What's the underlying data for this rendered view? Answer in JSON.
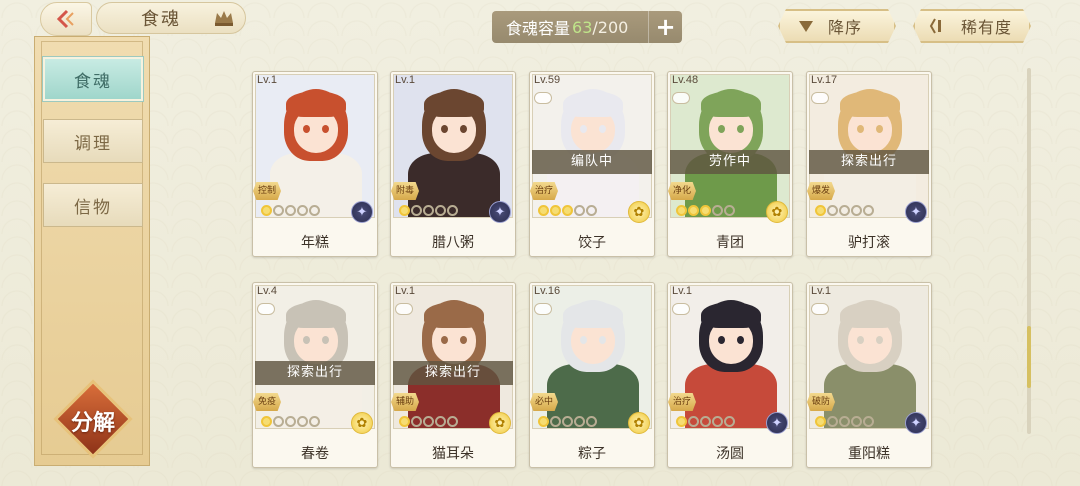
{
  "header": {
    "title": "食魂",
    "capacity_label": "食魂容量",
    "capacity_current": "63",
    "capacity_max": "/200",
    "add_label": "+",
    "sort_order_label": "降序",
    "sort_by_label": "稀有度"
  },
  "sidebar": {
    "tabs": [
      {
        "label": "食魂",
        "active": true
      },
      {
        "label": "调理",
        "active": false
      },
      {
        "label": "信物",
        "active": false
      }
    ],
    "decompose_label": "分解"
  },
  "scroll": {
    "position_fraction": 0.85
  },
  "cards": [
    {
      "level": "Lv.1",
      "name": "年糕",
      "role": "控制",
      "stars_filled": 1,
      "stars_total": 5,
      "element": "dark",
      "status": "",
      "palette": {
        "hair": "#c8502e",
        "body": "#f4f0e8",
        "bg": "#e9ecf4"
      }
    },
    {
      "level": "Lv.1",
      "name": "腊八粥",
      "role": "附毒",
      "stars_filled": 1,
      "stars_total": 5,
      "element": "dark",
      "status": "",
      "palette": {
        "hair": "#6b4630",
        "body": "#3b2b2a",
        "bg": "#dfe2ee"
      }
    },
    {
      "level": "Lv.59",
      "name": "饺子",
      "role": "治疗",
      "stars_filled": 3,
      "stars_total": 5,
      "element": "gold",
      "status": "编队中",
      "palette": {
        "hair": "#e9e9ef",
        "body": "#f4f0f2",
        "bg": "#f3f1ec"
      }
    },
    {
      "level": "Lv.48",
      "name": "青团",
      "role": "净化",
      "stars_filled": 3,
      "stars_total": 5,
      "element": "gold",
      "status": "劳作中",
      "palette": {
        "hair": "#7fa45a",
        "body": "#6e9a4a",
        "bg": "#dde9cf"
      }
    },
    {
      "level": "Lv.17",
      "name": "驴打滚",
      "role": "爆发",
      "stars_filled": 1,
      "stars_total": 5,
      "element": "dark",
      "status": "探索出行",
      "palette": {
        "hair": "#e0b878",
        "body": "#f3eee4",
        "bg": "#f3ece0"
      }
    },
    {
      "level": "Lv.4",
      "name": "春卷",
      "role": "免疫",
      "stars_filled": 1,
      "stars_total": 5,
      "element": "gold",
      "status": "探索出行",
      "palette": {
        "hair": "#c8c2b6",
        "body": "#f4efe6",
        "bg": "#f2efe6"
      }
    },
    {
      "level": "Lv.1",
      "name": "猫耳朵",
      "role": "辅助",
      "stars_filled": 1,
      "stars_total": 5,
      "element": "gold",
      "status": "探索出行",
      "palette": {
        "hair": "#9a6a48",
        "body": "#8b2e2a",
        "bg": "#efe9df"
      }
    },
    {
      "level": "Lv.16",
      "name": "粽子",
      "role": "必中",
      "stars_filled": 1,
      "stars_total": 5,
      "element": "gold",
      "status": "",
      "palette": {
        "hair": "#e4e6e8",
        "body": "#4d6b4a",
        "bg": "#ecefe7"
      }
    },
    {
      "level": "Lv.1",
      "name": "汤圆",
      "role": "治疗",
      "stars_filled": 1,
      "stars_total": 5,
      "element": "dark",
      "status": "",
      "palette": {
        "hair": "#2a2630",
        "body": "#c64a3a",
        "bg": "#f2eee9"
      }
    },
    {
      "level": "Lv.1",
      "name": "重阳糕",
      "role": "破防",
      "stars_filled": 1,
      "stars_total": 5,
      "element": "dark",
      "status": "",
      "palette": {
        "hair": "#d8d0c2",
        "body": "#8a8f6a",
        "bg": "#eeeae0"
      }
    }
  ]
}
